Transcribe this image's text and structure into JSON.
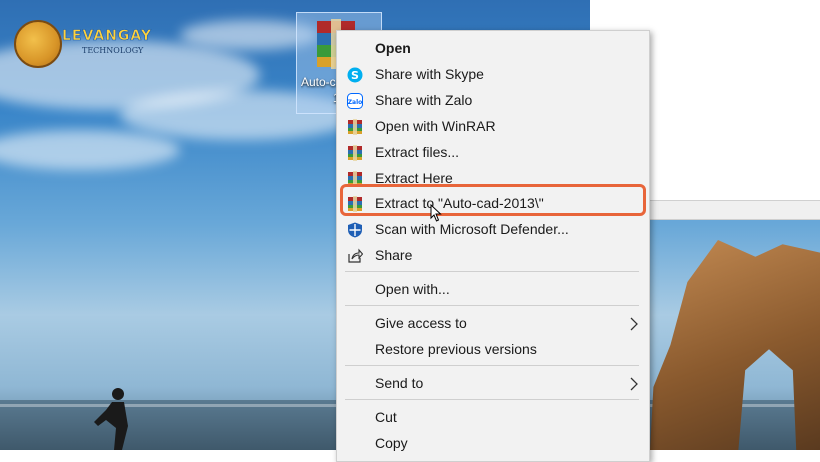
{
  "logo": {
    "title": "LEVANGAY",
    "subtitle": "TECHNOLOGY"
  },
  "desktop_file": {
    "label_line1": "Auto-cad-2013",
    "label_line2": "1"
  },
  "context_menu": {
    "items": [
      {
        "label": "Open",
        "icon": "none",
        "bold": true
      },
      {
        "label": "Share with Skype",
        "icon": "skype-icon"
      },
      {
        "label": "Share with Zalo",
        "icon": "zalo-icon"
      },
      {
        "label": "Open with WinRAR",
        "icon": "winrar-icon"
      },
      {
        "label": "Extract files...",
        "icon": "winrar-icon"
      },
      {
        "label": "Extract Here",
        "icon": "winrar-icon"
      },
      {
        "label": "Extract to \"Auto-cad-2013\\\"",
        "icon": "winrar-icon",
        "highlighted": true
      },
      {
        "label": "Scan with Microsoft Defender...",
        "icon": "defender-shield-icon"
      },
      {
        "label": "Share",
        "icon": "share-icon"
      },
      {
        "label": "Open with...",
        "icon": "none"
      },
      {
        "label": "Give access to",
        "icon": "none",
        "submenu": true
      },
      {
        "label": "Restore previous versions",
        "icon": "none"
      },
      {
        "label": "Send to",
        "icon": "none",
        "submenu": true
      },
      {
        "label": "Cut",
        "icon": "none"
      },
      {
        "label": "Copy",
        "icon": "none"
      }
    ]
  },
  "colors": {
    "highlight_border": "#e8653a",
    "menu_background": "#f2f2f2",
    "skype_blue": "#00aff0",
    "zalo_blue": "#0068ff"
  }
}
